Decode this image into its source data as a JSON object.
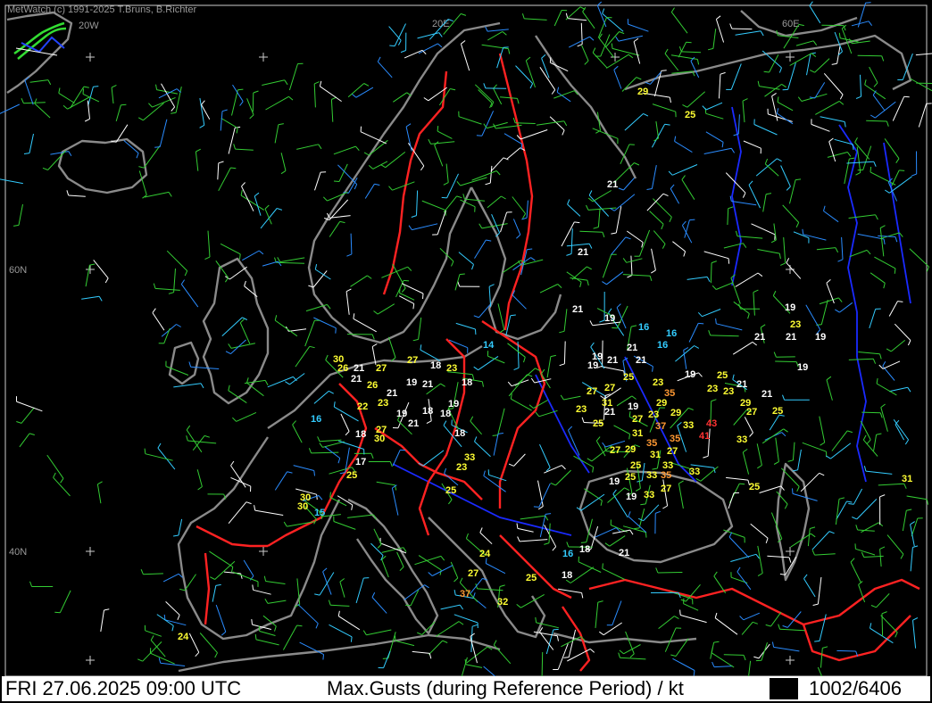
{
  "app": {
    "credit": "MetWatch (c) 1991-2025 T.Bruns, B.Richter"
  },
  "grid_labels": {
    "lon_20w": "20W",
    "lon_20e": "20E",
    "lon_60e": "60E",
    "lat_60n": "60N",
    "lat_40n": "40N"
  },
  "status": {
    "datetime": "FRI 27.06.2025 09:00 UTC",
    "product": "Max.Gusts (during Reference Period) / kt",
    "count": "1002/6406"
  },
  "colors": {
    "low": "#ffffff",
    "mid": "#ffff33",
    "high": "#ff9933",
    "severe": "#ff3333",
    "calm": "#33ccff",
    "border": "#ff2222",
    "coast": "#8a8a8a",
    "river": "#1a2aff"
  },
  "gust_labels": [
    {
      "v": "29",
      "c": "mid"
    },
    {
      "v": "25",
      "c": "mid"
    },
    {
      "v": "21",
      "c": "low"
    },
    {
      "v": "21",
      "c": "low"
    },
    {
      "v": "21",
      "c": "low"
    },
    {
      "v": "19",
      "c": "low"
    },
    {
      "v": "16",
      "c": "calm"
    },
    {
      "v": "16",
      "c": "calm"
    },
    {
      "v": "16",
      "c": "calm"
    },
    {
      "v": "21",
      "c": "low"
    },
    {
      "v": "19",
      "c": "low"
    },
    {
      "v": "23",
      "c": "mid"
    },
    {
      "v": "21",
      "c": "low"
    },
    {
      "v": "21",
      "c": "low"
    },
    {
      "v": "19",
      "c": "low"
    },
    {
      "v": "14",
      "c": "calm"
    },
    {
      "v": "30",
      "c": "mid"
    },
    {
      "v": "26",
      "c": "mid"
    },
    {
      "v": "21",
      "c": "low"
    },
    {
      "v": "27",
      "c": "mid"
    },
    {
      "v": "27",
      "c": "mid"
    },
    {
      "v": "18",
      "c": "low"
    },
    {
      "v": "23",
      "c": "mid"
    },
    {
      "v": "21",
      "c": "low"
    },
    {
      "v": "26",
      "c": "mid"
    },
    {
      "v": "21",
      "c": "low"
    },
    {
      "v": "19",
      "c": "low"
    },
    {
      "v": "21",
      "c": "low"
    },
    {
      "v": "18",
      "c": "low"
    },
    {
      "v": "19",
      "c": "low"
    },
    {
      "v": "19",
      "c": "low"
    },
    {
      "v": "21",
      "c": "low"
    },
    {
      "v": "21",
      "c": "low"
    },
    {
      "v": "25",
      "c": "mid"
    },
    {
      "v": "23",
      "c": "mid"
    },
    {
      "v": "19",
      "c": "low"
    },
    {
      "v": "25",
      "c": "mid"
    },
    {
      "v": "21",
      "c": "low"
    },
    {
      "v": "19",
      "c": "low"
    },
    {
      "v": "27",
      "c": "mid"
    },
    {
      "v": "27",
      "c": "mid"
    },
    {
      "v": "35",
      "c": "high"
    },
    {
      "v": "23",
      "c": "mid"
    },
    {
      "v": "23",
      "c": "mid"
    },
    {
      "v": "29",
      "c": "mid"
    },
    {
      "v": "27",
      "c": "mid"
    },
    {
      "v": "25",
      "c": "mid"
    },
    {
      "v": "21",
      "c": "low"
    },
    {
      "v": "22",
      "c": "mid"
    },
    {
      "v": "23",
      "c": "mid"
    },
    {
      "v": "19",
      "c": "low"
    },
    {
      "v": "18",
      "c": "low"
    },
    {
      "v": "18",
      "c": "low"
    },
    {
      "v": "19",
      "c": "low"
    },
    {
      "v": "16",
      "c": "calm"
    },
    {
      "v": "21",
      "c": "low"
    },
    {
      "v": "27",
      "c": "mid"
    },
    {
      "v": "18",
      "c": "low"
    },
    {
      "v": "30",
      "c": "mid"
    },
    {
      "v": "18",
      "c": "low"
    },
    {
      "v": "23",
      "c": "mid"
    },
    {
      "v": "31",
      "c": "mid"
    },
    {
      "v": "21",
      "c": "low"
    },
    {
      "v": "19",
      "c": "low"
    },
    {
      "v": "29",
      "c": "mid"
    },
    {
      "v": "23",
      "c": "mid"
    },
    {
      "v": "29",
      "c": "mid"
    },
    {
      "v": "27",
      "c": "mid"
    },
    {
      "v": "43",
      "c": "severe"
    },
    {
      "v": "37",
      "c": "high"
    },
    {
      "v": "33",
      "c": "mid"
    },
    {
      "v": "25",
      "c": "mid"
    },
    {
      "v": "31",
      "c": "mid"
    },
    {
      "v": "35",
      "c": "high"
    },
    {
      "v": "35",
      "c": "high"
    },
    {
      "v": "41",
      "c": "severe"
    },
    {
      "v": "33",
      "c": "mid"
    },
    {
      "v": "27",
      "c": "mid"
    },
    {
      "v": "29",
      "c": "mid"
    },
    {
      "v": "31",
      "c": "mid"
    },
    {
      "v": "27",
      "c": "mid"
    },
    {
      "v": "17",
      "c": "low"
    },
    {
      "v": "25",
      "c": "mid"
    },
    {
      "v": "33",
      "c": "mid"
    },
    {
      "v": "23",
      "c": "mid"
    },
    {
      "v": "25",
      "c": "mid"
    },
    {
      "v": "25",
      "c": "mid"
    },
    {
      "v": "33",
      "c": "mid"
    },
    {
      "v": "35",
      "c": "high"
    },
    {
      "v": "33",
      "c": "mid"
    },
    {
      "v": "33",
      "c": "mid"
    },
    {
      "v": "19",
      "c": "low"
    },
    {
      "v": "19",
      "c": "low"
    },
    {
      "v": "33",
      "c": "mid"
    },
    {
      "v": "27",
      "c": "mid"
    },
    {
      "v": "25",
      "c": "mid"
    },
    {
      "v": "25",
      "c": "mid"
    },
    {
      "v": "30",
      "c": "mid"
    },
    {
      "v": "30",
      "c": "mid"
    },
    {
      "v": "15",
      "c": "calm"
    },
    {
      "v": "31",
      "c": "mid"
    },
    {
      "v": "24",
      "c": "mid"
    },
    {
      "v": "18",
      "c": "low"
    },
    {
      "v": "16",
      "c": "calm"
    },
    {
      "v": "21",
      "c": "low"
    },
    {
      "v": "18",
      "c": "low"
    },
    {
      "v": "27",
      "c": "mid"
    },
    {
      "v": "25",
      "c": "mid"
    },
    {
      "v": "37",
      "c": "high"
    },
    {
      "v": "32",
      "c": "mid"
    },
    {
      "v": "24",
      "c": "mid"
    },
    {
      "v": "19",
      "c": "low"
    }
  ]
}
